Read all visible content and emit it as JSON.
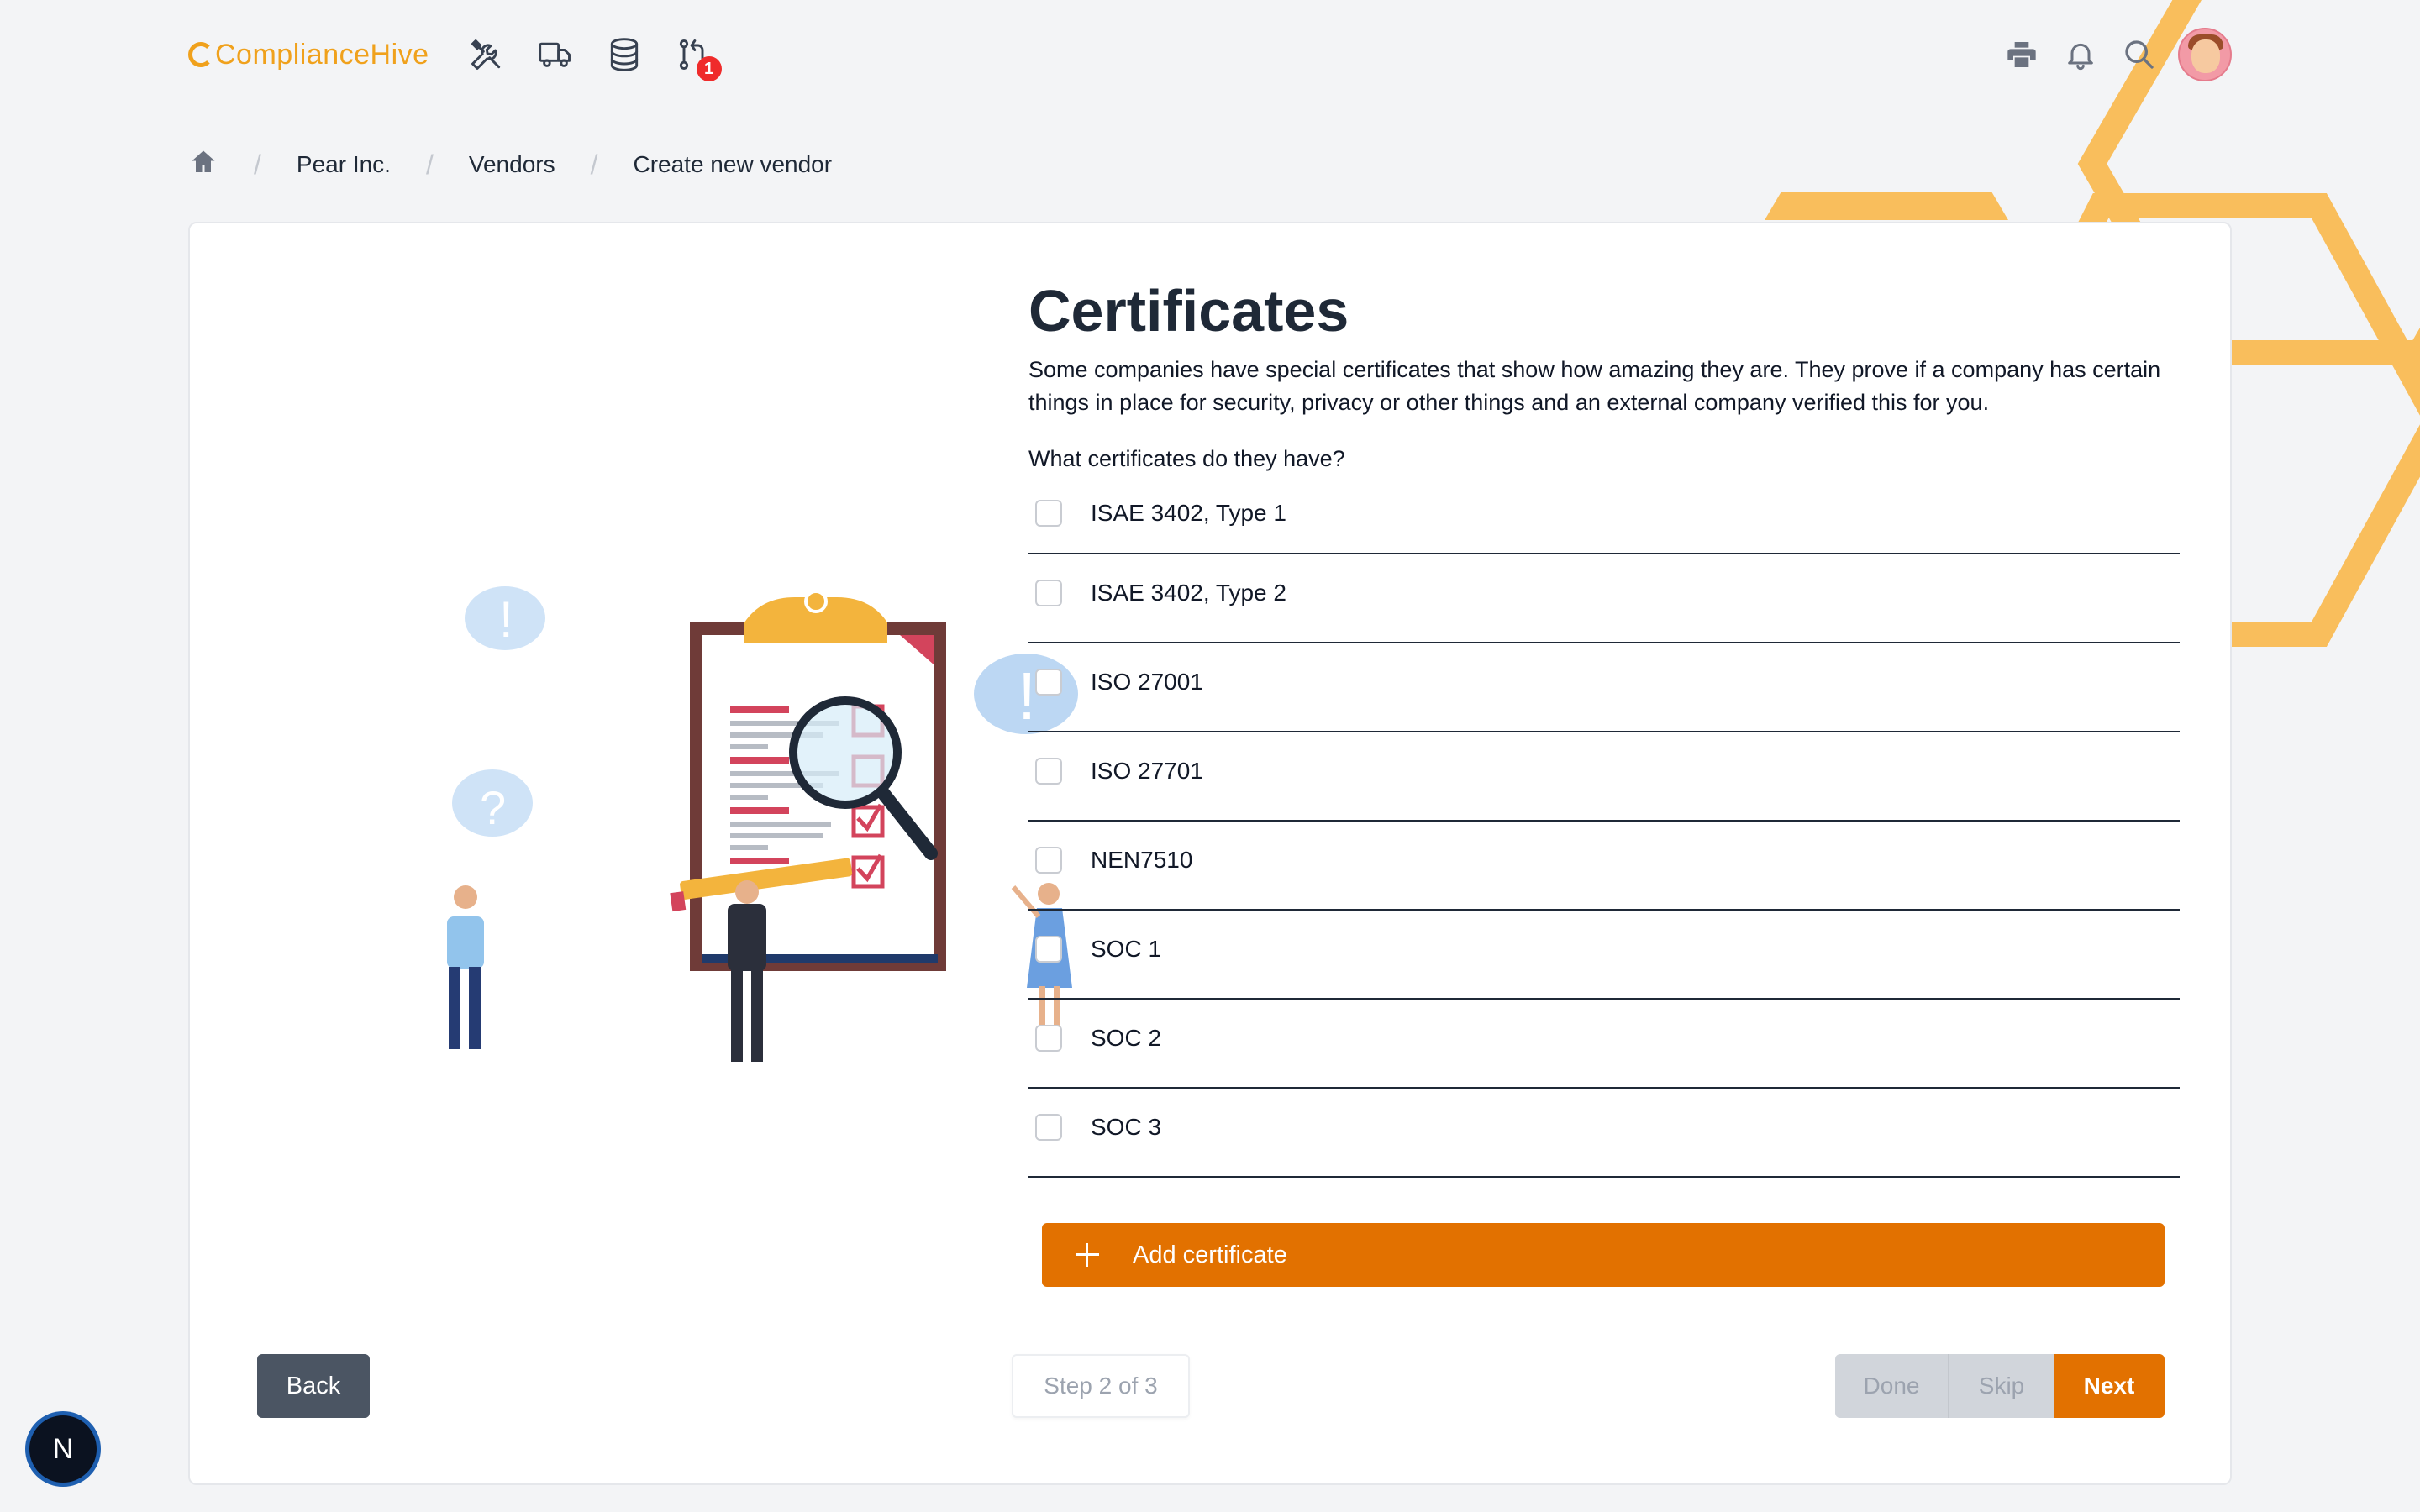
{
  "brand": {
    "name": "ComplianceHive",
    "accent": "#f0a11c"
  },
  "nav": {
    "icons": [
      "tools-icon",
      "truck-icon",
      "database-icon",
      "git-pull-request-icon"
    ],
    "notification_count": "1",
    "right_icons": [
      "printer-icon",
      "bell-icon",
      "search-icon"
    ]
  },
  "breadcrumb": {
    "items": [
      "Pear Inc.",
      "Vendors",
      "Create new vendor"
    ],
    "separator": "/"
  },
  "main": {
    "title": "Certificates",
    "description": "Some companies have special certificates that show how amazing they are. They prove if a company has certain things in place for security, privacy or other things and an external company verified this for you.",
    "question": "What certificates do they have?",
    "certificates": [
      {
        "label": "ISAE 3402, Type 1",
        "checked": false
      },
      {
        "label": "ISAE 3402, Type 2",
        "checked": false
      },
      {
        "label": "ISO 27001",
        "checked": false
      },
      {
        "label": "ISO 27701",
        "checked": false
      },
      {
        "label": "NEN7510",
        "checked": false
      },
      {
        "label": "SOC 1",
        "checked": false
      },
      {
        "label": "SOC 2",
        "checked": false
      },
      {
        "label": "SOC 3",
        "checked": false
      }
    ],
    "add_label": "Add certificate"
  },
  "footer": {
    "back_label": "Back",
    "step_label": "Step 2 of 3",
    "done_label": "Done",
    "skip_label": "Skip",
    "next_label": "Next"
  },
  "floating": {
    "label": "N"
  },
  "colors": {
    "primary": "#e27100",
    "dark_button": "#4b5563",
    "hex_decoration": "#f9be5c"
  }
}
